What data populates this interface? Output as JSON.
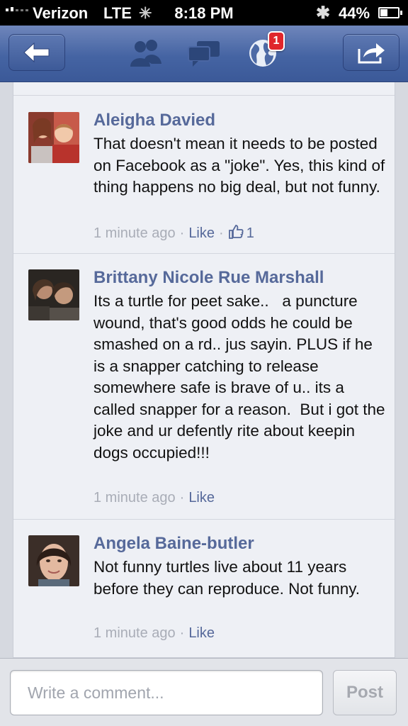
{
  "status_bar": {
    "carrier": "Verizon",
    "network": "LTE",
    "time": "8:18 PM",
    "battery": "44%",
    "battery_level": 0.44
  },
  "nav": {
    "back_icon": "back-arrow-icon",
    "friends_icon": "friends-icon",
    "messages_icon": "messages-icon",
    "notifications_icon": "globe-icon",
    "notifications_badge": "1",
    "share_icon": "share-icon"
  },
  "comments": [
    {
      "author": "Aleigha Davied",
      "text": "That doesn't mean it needs to be posted on Facebook as a \"joke\". Yes, this kind of thing happens no big deal, but not funny.",
      "time": "1 minute ago",
      "like_label": "Like",
      "likes": "1"
    },
    {
      "author": "Brittany Nicole Rue Marshall",
      "text": "Its a turtle for peet sake..   a puncture wound, that's good odds he could be smashed on a rd.. jus sayin. PLUS if he is a snapper catching to release somewhere safe is brave of u.. its a called snapper for a reason.  But i got the joke and ur defently rite about keepin dogs occupied!!!",
      "time": "1 minute ago",
      "like_label": "Like"
    },
    {
      "author": "Angela Baine-butler",
      "text": "Not funny turtles live about 11 years before they can reproduce. Not funny.",
      "time": "1 minute ago",
      "like_label": "Like"
    }
  ],
  "composer": {
    "placeholder": "Write a comment...",
    "post_label": "Post"
  },
  "colors": {
    "nav_blue": "#3b5998",
    "name_blue": "#56699a",
    "badge_red": "#e0262c"
  }
}
